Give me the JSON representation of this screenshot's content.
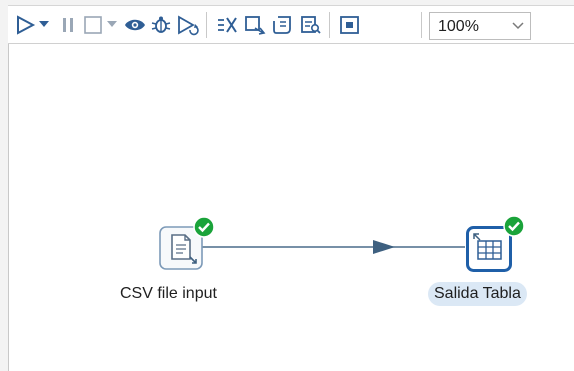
{
  "toolbar": {
    "buttons": [
      {
        "name": "run",
        "icon": "play-icon"
      },
      {
        "name": "run-options",
        "icon": "dropdown-arrow-icon"
      },
      {
        "name": "pause",
        "icon": "pause-icon"
      },
      {
        "name": "stop",
        "icon": "stop-icon"
      },
      {
        "name": "stop-options",
        "icon": "dropdown-arrow-icon"
      },
      {
        "name": "preview",
        "icon": "eye-icon"
      },
      {
        "name": "debug",
        "icon": "bug-icon"
      },
      {
        "name": "replay",
        "icon": "replay-icon"
      },
      {
        "name": "verify",
        "icon": "verify-icon"
      },
      {
        "name": "impact-analysis",
        "icon": "impact-icon"
      },
      {
        "name": "sql",
        "icon": "sql-script-icon"
      },
      {
        "name": "explore-db",
        "icon": "explore-db-icon"
      },
      {
        "name": "show-results",
        "icon": "results-panel-icon"
      }
    ],
    "zoom": {
      "value": "100%",
      "icon": "chevron-down-icon"
    }
  },
  "canvas": {
    "steps": [
      {
        "label": "CSV file input",
        "icon": "csv-file-icon",
        "status_icon": "check-icon",
        "status_color": "#1aa33a",
        "selected": false
      },
      {
        "label": "Salida Tabla",
        "icon": "table-output-icon",
        "status_icon": "check-icon",
        "status_color": "#1aa33a",
        "selected": true
      }
    ],
    "hop": {
      "from": "CSV file input",
      "to": "Salida Tabla",
      "color": "#4a6b8a"
    }
  },
  "colors": {
    "icon_blue": "#2f5e95",
    "accent": "#1f5fa8",
    "selection": "#dbe8f5"
  }
}
